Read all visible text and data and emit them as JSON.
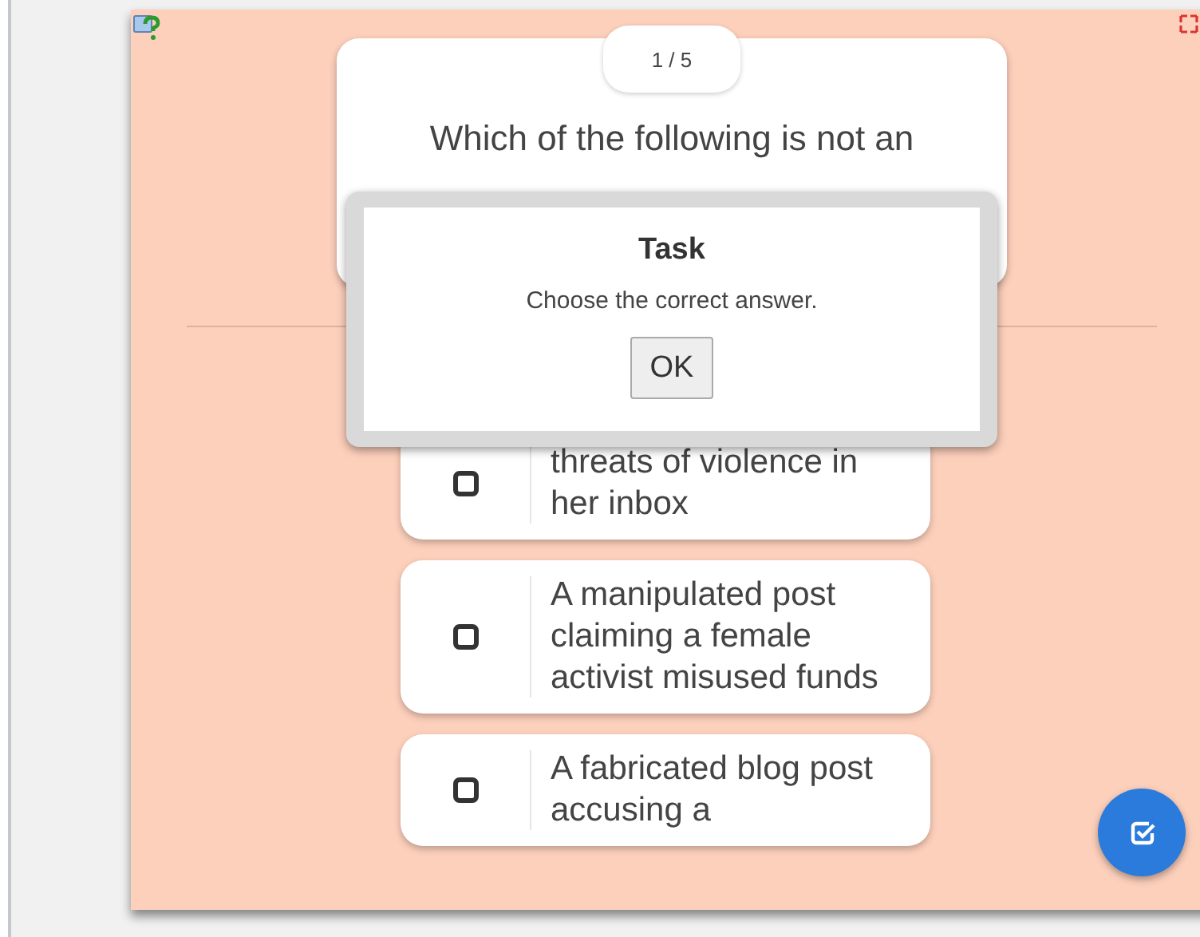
{
  "counter": "1 / 5",
  "question": "Which of the following is not an",
  "options": [
    {
      "text": "threats of violence in her inbox",
      "checked": false
    },
    {
      "text": "A manipulated post claiming a female activist misused funds",
      "checked": false
    },
    {
      "text": "A fabricated blog post accusing a",
      "checked": false
    }
  ],
  "dialog": {
    "title": "Task",
    "message": "Choose the correct answer.",
    "button": "OK"
  }
}
